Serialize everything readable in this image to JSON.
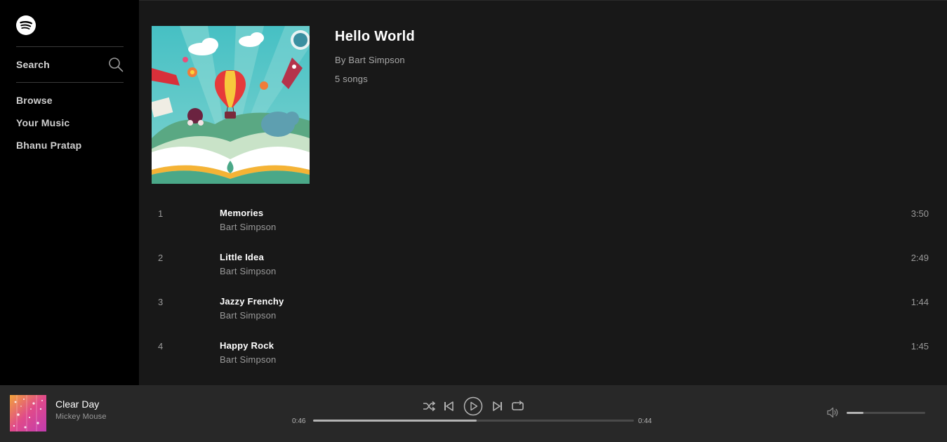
{
  "sidebar": {
    "logo_icon": "spotify-logo-icon",
    "search": {
      "label": "Search",
      "icon": "search-icon"
    },
    "nav": [
      {
        "label": "Browse"
      },
      {
        "label": "Your Music"
      },
      {
        "label": "Bhanu Pratap"
      }
    ]
  },
  "playlist": {
    "title": "Hello World",
    "owner": "By Bart Simpson",
    "count": "5 songs",
    "art": "storybook-hot-air-balloon-illustration"
  },
  "tracks": [
    {
      "number": "1",
      "title": "Memories",
      "artist": "Bart Simpson",
      "duration": "3:50"
    },
    {
      "number": "2",
      "title": "Little Idea",
      "artist": "Bart Simpson",
      "duration": "2:49"
    },
    {
      "number": "3",
      "title": "Jazzy Frenchy",
      "artist": "Bart Simpson",
      "duration": "1:44"
    },
    {
      "number": "4",
      "title": "Happy Rock",
      "artist": "Bart Simpson",
      "duration": "1:45"
    }
  ],
  "player": {
    "now_playing": {
      "title": "Clear Day",
      "artist": "Mickey Mouse"
    },
    "controls": [
      "shuffle-icon",
      "previous-icon",
      "play-icon",
      "next-icon",
      "repeat-icon"
    ],
    "time_current": "0:46",
    "time_total": "0:44",
    "progress_fraction": 0.51,
    "volume_fraction": 0.21
  },
  "colors": {
    "sidebar_bg": "#000000",
    "main_bg": "#181818",
    "player_bg": "#282828",
    "text_primary": "#ffffff",
    "text_secondary": "#9a9a9a"
  }
}
